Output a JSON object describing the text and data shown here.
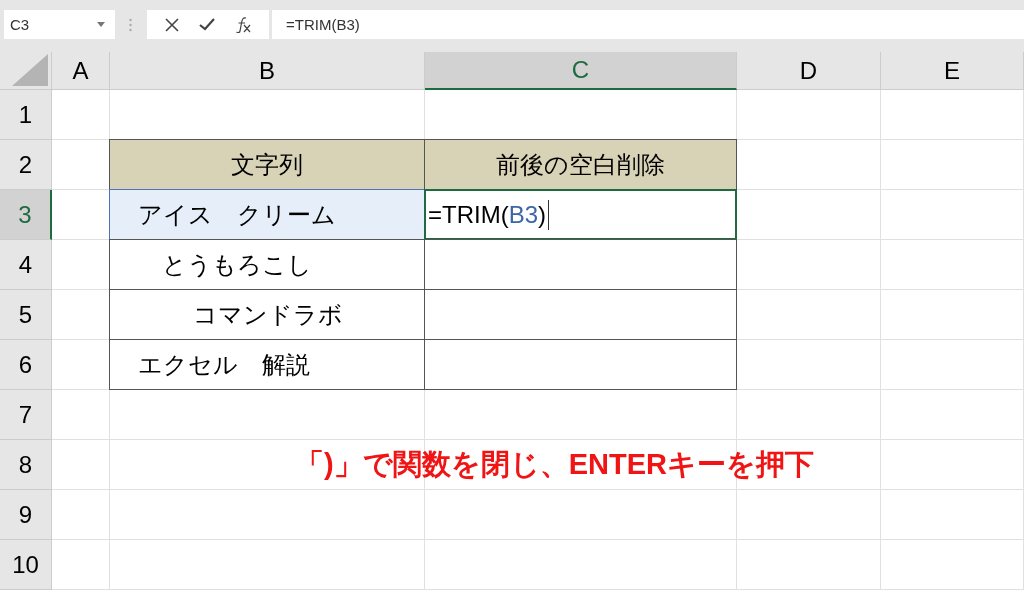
{
  "formula_bar": {
    "name_box": "C3",
    "formula": "=TRIM(B3)"
  },
  "columns": [
    {
      "label": "A",
      "selected": false
    },
    {
      "label": "B",
      "selected": false
    },
    {
      "label": "C",
      "selected": true
    },
    {
      "label": "D",
      "selected": false
    },
    {
      "label": "E",
      "selected": false
    }
  ],
  "rows": [
    {
      "label": "1",
      "selected": false
    },
    {
      "label": "2",
      "selected": false
    },
    {
      "label": "3",
      "selected": true
    },
    {
      "label": "4",
      "selected": false
    },
    {
      "label": "5",
      "selected": false
    },
    {
      "label": "6",
      "selected": false
    },
    {
      "label": "7",
      "selected": false
    },
    {
      "label": "8",
      "selected": false
    },
    {
      "label": "9",
      "selected": false
    },
    {
      "label": "10",
      "selected": false
    }
  ],
  "table": {
    "headers": [
      "文字列",
      "前後の空白削除"
    ],
    "rows": [
      {
        "text": "　アイス　クリーム",
        "referenced": true,
        "active": true,
        "editing": {
          "before": "=TRIM(",
          "reference": "B3",
          "after": ")"
        }
      },
      {
        "text": "　　とうもろこし",
        "referenced": false,
        "active": false
      },
      {
        "text": "　　　 コマンドラボ",
        "referenced": false,
        "active": false
      },
      {
        "text": "　エクセル　解説",
        "referenced": false,
        "active": false
      }
    ]
  },
  "note": "「)」で関数を閉じ、ENTERキーを押下"
}
